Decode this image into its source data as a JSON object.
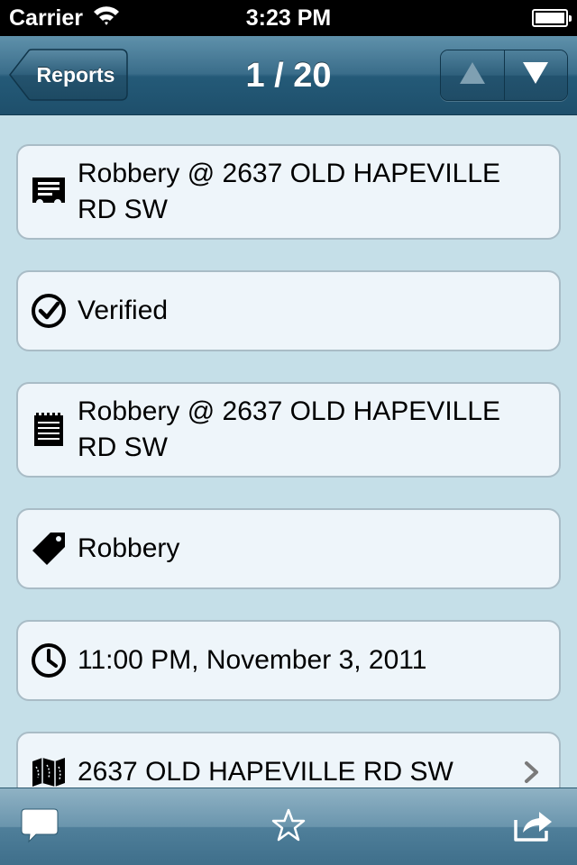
{
  "status": {
    "carrier": "Carrier",
    "time": "3:23 PM"
  },
  "nav": {
    "back_label": "Reports",
    "title": "1 / 20"
  },
  "cells": [
    {
      "icon": "report-title-icon",
      "text": "Robbery @ 2637 OLD HAPEVILLE RD SW"
    },
    {
      "icon": "verified-check-icon",
      "text": "Verified"
    },
    {
      "icon": "notepad-icon",
      "text": "Robbery @ 2637 OLD HAPEVILLE RD SW"
    },
    {
      "icon": "tag-icon",
      "text": "Robbery"
    },
    {
      "icon": "clock-icon",
      "text": "11:00 PM, November 3, 2011"
    },
    {
      "icon": "map-icon",
      "text": "2637 OLD HAPEVILLE RD SW"
    }
  ],
  "toolbar": {
    "icons": [
      "comment-icon",
      "star-icon",
      "share-icon"
    ]
  },
  "colors": {
    "background": "#c5dfe8",
    "nav_bar": "#2f607c",
    "cell_background": "#eef5fa",
    "cell_border": "#a9bcc6"
  }
}
